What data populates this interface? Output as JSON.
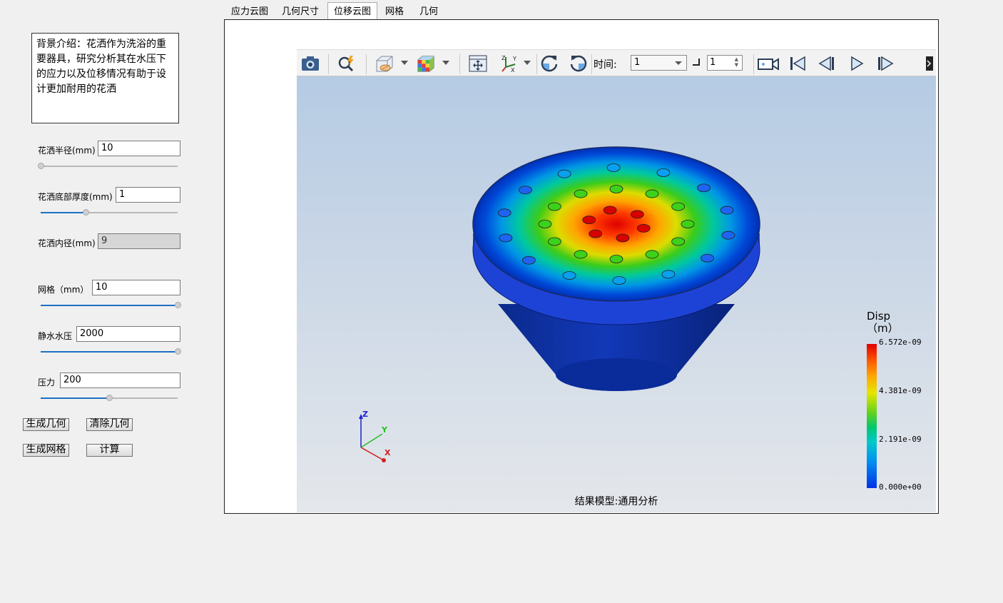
{
  "intro_text": "背景介绍：花洒作为洗浴的重要器具，研究分析其在水压下的应力以及位移情况有助于设计更加耐用的花洒",
  "params": {
    "radius": {
      "label": "花洒半径(mm)",
      "value": "10",
      "slider": 0.0
    },
    "bottom_thickness": {
      "label": "花洒底部厚度(mm)",
      "value": "1",
      "slider": 0.33
    },
    "inner_diameter": {
      "label": "花洒内径(mm)",
      "value": "9"
    },
    "mesh": {
      "label": "网格（mm）",
      "value": "10",
      "slider": 1.0
    },
    "static_pressure": {
      "label": "静水水压",
      "value": "2000",
      "slider": 1.0
    },
    "pressure": {
      "label": "压力",
      "value": "200",
      "slider": 0.5
    }
  },
  "buttons": {
    "gen_geometry": "生成几何",
    "clear_geometry": "清除几何",
    "gen_mesh": "生成网格",
    "compute": "计算"
  },
  "tabs": [
    "应力云图",
    "几何尺寸",
    "位移云图",
    "网格",
    "几何"
  ],
  "active_tab": "位移云图",
  "toolbar": {
    "time_label": "时间:",
    "time_value": "1",
    "step_value": "1"
  },
  "legend": {
    "title_line1": "Disp",
    "title_line2": "（m）",
    "labels": [
      "6.572e-09",
      "4.381e-09",
      "2.191e-09",
      "0.000e+00"
    ]
  },
  "axes": {
    "z": "Z",
    "y": "Y",
    "x": "X"
  },
  "model_caption": "结果模型:通用分析",
  "colors": {
    "accent": "#1e6fc4",
    "panel_border": "#222222"
  }
}
